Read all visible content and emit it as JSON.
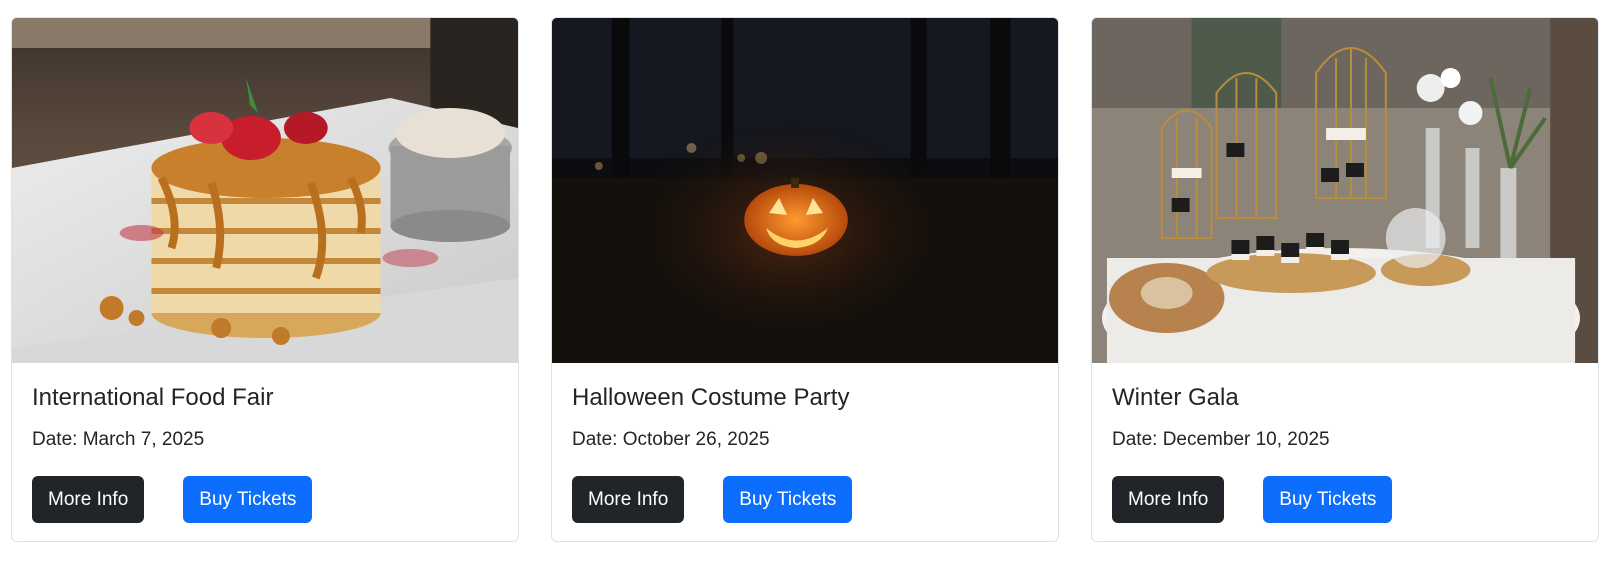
{
  "events": [
    {
      "title": "International Food Fair",
      "date": "Date: March 7, 2025",
      "more_info_label": "More Info",
      "buy_tickets_label": "Buy Tickets",
      "image": "pancake-stack-photo"
    },
    {
      "title": "Halloween Costume Party",
      "date": "Date: October 26, 2025",
      "more_info_label": "More Info",
      "buy_tickets_label": "Buy Tickets",
      "image": "jack-o-lantern-photo"
    },
    {
      "title": "Winter Gala",
      "date": "Date: December 10, 2025",
      "more_info_label": "More Info",
      "buy_tickets_label": "Buy Tickets",
      "image": "dessert-table-photo"
    }
  ],
  "colors": {
    "button_dark": "#212529",
    "button_primary": "#0d6efd",
    "card_border": "#dee2e6"
  }
}
